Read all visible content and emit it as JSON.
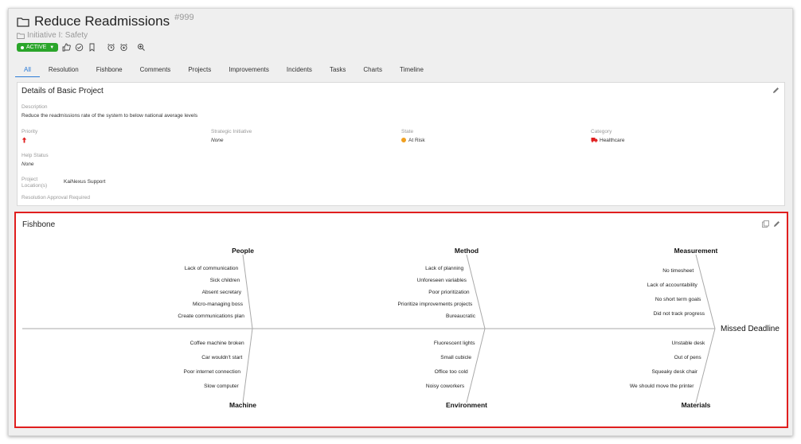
{
  "header": {
    "title": "Reduce Readmissions",
    "id": "#999",
    "initiative": "Initiative I: Safety",
    "status": "ACTIVE"
  },
  "tabs": [
    "All",
    "Resolution",
    "Fishbone",
    "Comments",
    "Projects",
    "Improvements",
    "Incidents",
    "Tasks",
    "Charts",
    "Timeline"
  ],
  "details": {
    "title": "Details of Basic Project",
    "description_label": "Description",
    "description": "Reduce the readmissions rate of the system to below national average levels",
    "priority_label": "Priority",
    "strategic_label": "Strategic Initiative",
    "strategic_value": "None",
    "state_label": "State",
    "state_value": "At Risk",
    "category_label": "Category",
    "category_value": "Healthcare",
    "help_label": "Help Status",
    "help_value": "None",
    "location_label_1": "Project",
    "location_label_2": "Location(s)",
    "location_value": "KaiNexus Support",
    "approval_label": "Resolution Approval Required"
  },
  "fishbone": {
    "title": "Fishbone",
    "head": "Missed Deadline",
    "top": [
      {
        "name": "People",
        "causes": [
          "Lack of communication",
          "Sick children",
          "Absent secretary",
          "Micro-managing boss",
          "Create communications plan"
        ]
      },
      {
        "name": "Method",
        "causes": [
          "Lack of planning",
          "Unforeseen variables",
          "Poor prioritization",
          "Prioritize improvements projects",
          "Bureaucratic"
        ]
      },
      {
        "name": "Measurement",
        "causes": [
          "No timesheet",
          "Lack of accountability",
          "No short term goals",
          "Did not track progress"
        ]
      }
    ],
    "bottom": [
      {
        "name": "Machine",
        "causes": [
          "Coffee machine broken",
          "Car wouldn't start",
          "Poor internet connection",
          "Slow computer"
        ]
      },
      {
        "name": "Environment",
        "causes": [
          "Fluorescent lights",
          "Small cubicle",
          "Office too cold",
          "Noisy coworkers"
        ]
      },
      {
        "name": "Materials",
        "causes": [
          "Unstable desk",
          "Out of pens",
          "Squeaky desk chair",
          "We should move the printer"
        ]
      }
    ]
  },
  "colors": {
    "accent": "#2b7bd6",
    "active": "#2aa52a",
    "at_risk": "#f0a020",
    "highlight": "#e01e1e",
    "priority": "#e01e1e"
  }
}
